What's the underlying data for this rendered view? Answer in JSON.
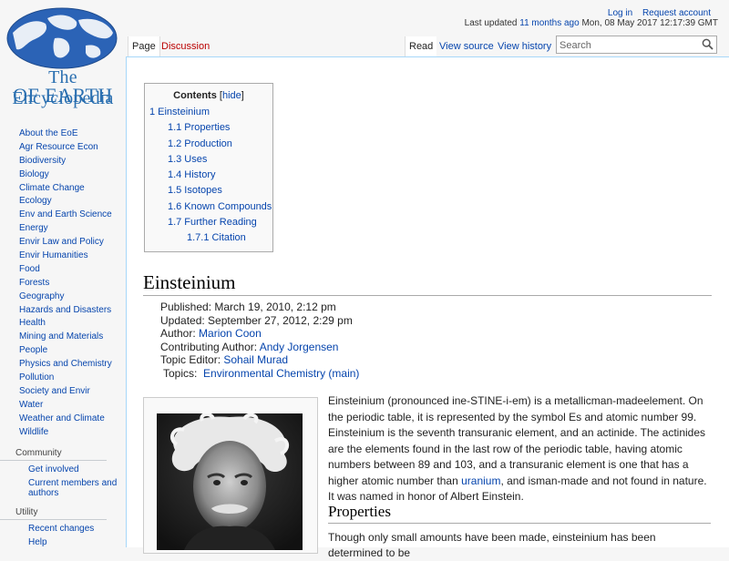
{
  "logo": {
    "line1": "The Encyclopedia",
    "line2": "OF EARTH"
  },
  "personal": {
    "login": "Log in",
    "request": "Request account"
  },
  "last_updated": {
    "prefix": "Last updated",
    "link": "11 months ago",
    "date": "Mon, 08 May 2017 12:17:39 GMT"
  },
  "tabs": {
    "page": "Page",
    "discussion": "Discussion",
    "read": "Read",
    "view_source": "View source",
    "view_history": "View history"
  },
  "search": {
    "placeholder": "Search"
  },
  "sidebar": {
    "items": [
      {
        "label": "About the EoE"
      },
      {
        "label": "Agr Resource Econ"
      },
      {
        "label": "Biodiversity"
      },
      {
        "label": "Biology"
      },
      {
        "label": "Climate Change"
      },
      {
        "label": "Ecology"
      },
      {
        "label": "Env and Earth Science"
      },
      {
        "label": "Energy"
      },
      {
        "label": "Envir Law and Policy"
      },
      {
        "label": "Envir Humanities"
      },
      {
        "label": "Food"
      },
      {
        "label": "Forests"
      },
      {
        "label": "Geography"
      },
      {
        "label": "Hazards and Disasters"
      },
      {
        "label": "Health"
      },
      {
        "label": "Mining and Materials"
      },
      {
        "label": "People"
      },
      {
        "label": "Physics and Chemistry"
      },
      {
        "label": "Pollution"
      },
      {
        "label": "Society and Envir"
      },
      {
        "label": "Water"
      },
      {
        "label": "Weather and Climate"
      },
      {
        "label": "Wildlife"
      }
    ],
    "community": {
      "heading": "Community",
      "items": [
        {
          "label": "Get involved"
        },
        {
          "label": "Current members and authors"
        }
      ]
    },
    "utility": {
      "heading": "Utility",
      "items": [
        {
          "label": "Recent changes"
        },
        {
          "label": "Help"
        }
      ]
    }
  },
  "toc": {
    "title": "Contents",
    "hide": "hide",
    "items": [
      {
        "num": "1",
        "label": "Einsteinium"
      },
      {
        "num": "1.1",
        "label": "Properties"
      },
      {
        "num": "1.2",
        "label": "Production"
      },
      {
        "num": "1.3",
        "label": "Uses"
      },
      {
        "num": "1.4",
        "label": "History"
      },
      {
        "num": "1.5",
        "label": "Isotopes"
      },
      {
        "num": "1.6",
        "label": "Known Compounds"
      },
      {
        "num": "1.7",
        "label": "Further Reading"
      },
      {
        "num": "1.7.1",
        "label": "Citation"
      }
    ]
  },
  "heading": "Einsteinium",
  "meta": {
    "published": "Published: March 19, 2010, 2:12 pm",
    "updated": "Updated: September 27, 2012, 2:29 pm",
    "author_label": "Author:",
    "author": "Marion Coon",
    "contrib_label": "Contributing Author:",
    "contrib": "Andy Jorgensen",
    "editor_label": "Topic Editor:",
    "editor": "Sohail Murad",
    "topics_label": "Topics:",
    "topics": "Environmental Chemistry (main)"
  },
  "intro": {
    "part1": "Einsteinium (pronounced ine-STINE-i-em) is a metallicman-madeelement. On the periodic table, it is represented by the symbol Es and atomic number 99. Einsteinium is the seventh transuranic element, and an actinide. The actinides are the elements found in the last row of the periodic table, having atomic numbers between 89 and 103, and a transuranic element is one that has a higher atomic number than",
    "link": "uranium",
    "part2": ", and isman-made and not found in nature. It was named in honor of Albert Einstein."
  },
  "properties": {
    "heading": "Properties",
    "text": "Though only small amounts have been made, einsteinium has been determined to be"
  }
}
